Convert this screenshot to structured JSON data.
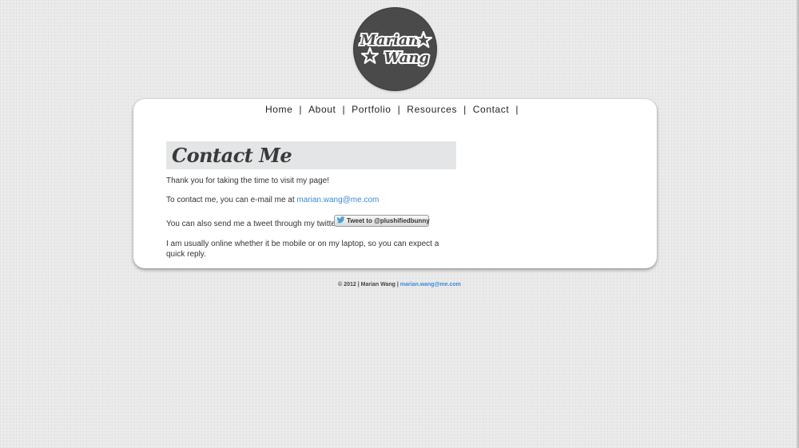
{
  "logo": {
    "line1": "Marian",
    "line2": "Wang",
    "icon": "star-icon"
  },
  "nav": {
    "items": [
      "Home",
      "About",
      "Portfolio",
      "Resources",
      "Contact"
    ],
    "separator": "|"
  },
  "content": {
    "title": "Contact Me",
    "p1": "Thank you for taking the time to visit my page!",
    "p2_prefix": "To contact me, you can e-mail me at ",
    "email": "marian.wang@me.com",
    "p3": "You can also send me a tweet through my twitter!",
    "tweet_button": "Tweet to @plushifiedbunny",
    "p4": "I am usually online whether it be mobile or on my laptop, so you can expect a quick reply."
  },
  "footer": {
    "text": "© 2012 | Marian Wang | ",
    "email": "marian.wang@me.com"
  },
  "colors": {
    "link": "#3b8ad8",
    "logo_bg": "#4a4a4a",
    "heading_bg": "#e4e5e6",
    "twitter_blue": "#4a9fd8"
  }
}
